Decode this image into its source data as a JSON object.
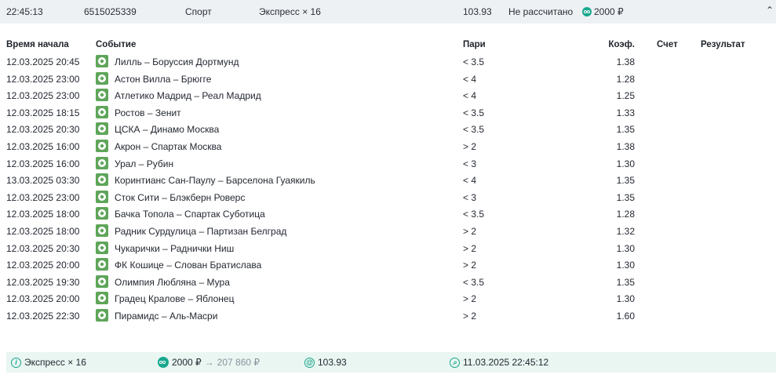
{
  "summary": {
    "time": "22:45:13",
    "bet_id": "6515025339",
    "sport": "Спорт",
    "type": "Экспресс × 16",
    "coefficient": "103.93",
    "status": "Не рассчитано",
    "stake": "2000 ₽"
  },
  "headers": {
    "start_time": "Время начала",
    "event": "Событие",
    "bet": "Пари",
    "coef": "Коэф.",
    "score": "Счет",
    "result": "Результат"
  },
  "rows": [
    {
      "time": "12.03.2025 20:45",
      "event": "Лилль – Боруссия Дортмунд",
      "bet": "< 3.5",
      "coef": "1.38"
    },
    {
      "time": "12.03.2025 23:00",
      "event": "Астон Вилла – Брюгге",
      "bet": "< 4",
      "coef": "1.28"
    },
    {
      "time": "12.03.2025 23:00",
      "event": "Атлетико Мадрид – Реал Мадрид",
      "bet": "< 4",
      "coef": "1.25"
    },
    {
      "time": "12.03.2025 18:15",
      "event": "Ростов – Зенит",
      "bet": "< 3.5",
      "coef": "1.33"
    },
    {
      "time": "12.03.2025 20:30",
      "event": "ЦСКА – Динамо Москва",
      "bet": "< 3.5",
      "coef": "1.35"
    },
    {
      "time": "12.03.2025 16:00",
      "event": "Акрон – Спартак Москва",
      "bet": "> 2",
      "coef": "1.38"
    },
    {
      "time": "12.03.2025 16:00",
      "event": "Урал – Рубин",
      "bet": "< 3",
      "coef": "1.30"
    },
    {
      "time": "13.03.2025 03:30",
      "event": "Коринтианс Сан-Паулу – Барселона Гуаякиль",
      "bet": "< 4",
      "coef": "1.35"
    },
    {
      "time": "12.03.2025 23:00",
      "event": "Сток Сити – Блэкберн Роверс",
      "bet": "< 3",
      "coef": "1.35"
    },
    {
      "time": "12.03.2025 18:00",
      "event": "Бачка Топола – Спартак Суботица",
      "bet": "< 3.5",
      "coef": "1.28"
    },
    {
      "time": "12.03.2025 18:00",
      "event": "Радник Сурдулица – Партизан Белград",
      "bet": "> 2",
      "coef": "1.32"
    },
    {
      "time": "12.03.2025 20:30",
      "event": "Чукарички – Раднички Ниш",
      "bet": "> 2",
      "coef": "1.30"
    },
    {
      "time": "12.03.2025 20:00",
      "event": "ФК Кошице – Слован Братислава",
      "bet": "> 2",
      "coef": "1.30"
    },
    {
      "time": "12.03.2025 19:30",
      "event": "Олимпия Любляна – Мура",
      "bet": "< 3.5",
      "coef": "1.35"
    },
    {
      "time": "12.03.2025 20:00",
      "event": "Градец Кралове – Яблонец",
      "bet": "> 2",
      "coef": "1.30"
    },
    {
      "time": "12.03.2025 22:30",
      "event": "Пирамидс – Аль-Масри",
      "bet": "> 2",
      "coef": "1.60"
    }
  ],
  "footer": {
    "type": "Экспресс × 16",
    "stake": "2000 ₽",
    "arrow": "→",
    "payout": "207 860 ₽",
    "coefficient": "103.93",
    "placed_at": "11.03.2025 22:45:12",
    "info_glyph": "i",
    "coef_glyph": "@",
    "clock_glyph": "⌕"
  },
  "icons": {
    "sport": "football-ball-icon",
    "coin": "coin-icon",
    "collapse": "chevron-up-icon",
    "info": "info-icon",
    "coef": "at-sign-icon",
    "time": "clock-icon"
  },
  "colors": {
    "accent": "#1aa58a",
    "sport_icon": "#5fa55a",
    "top_bar_bg": "#eef1f4",
    "footer_bg": "#e9f6f2"
  },
  "chevron": "⌃"
}
